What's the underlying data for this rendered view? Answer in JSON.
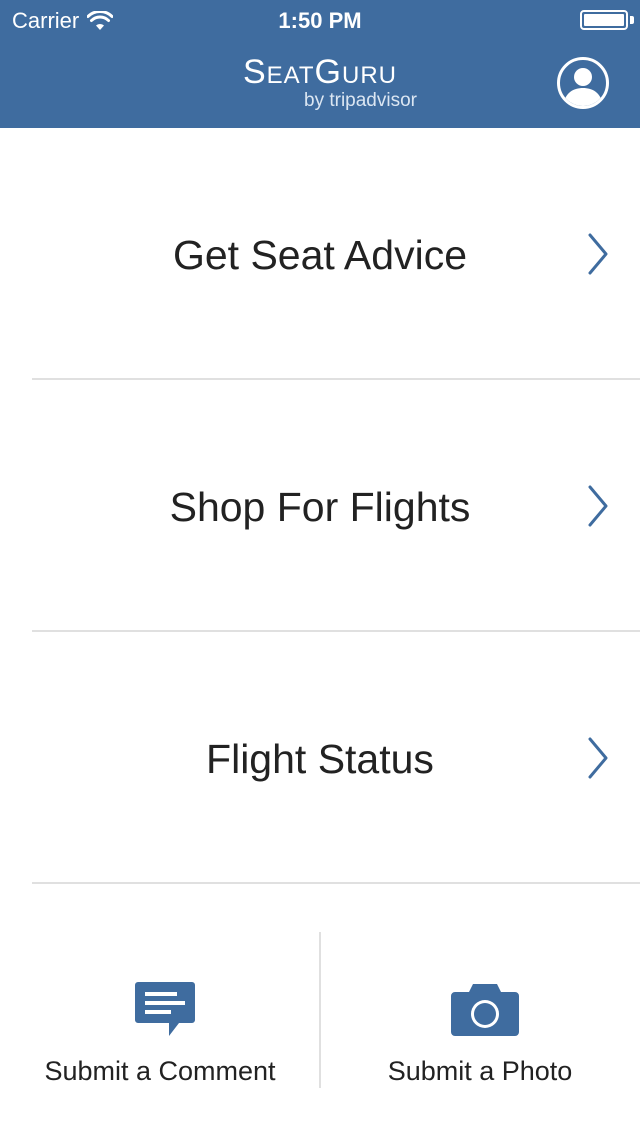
{
  "status_bar": {
    "carrier": "Carrier",
    "time": "1:50 PM"
  },
  "header": {
    "logo_main": "SeatGuru",
    "logo_sub": "by tripadvisor",
    "background_color": "#3f6c9f"
  },
  "menu": {
    "items": [
      {
        "label": "Get Seat Advice"
      },
      {
        "label": "Shop For Flights"
      },
      {
        "label": "Flight Status"
      }
    ],
    "chevron_color": "#3f6c9f"
  },
  "bottom_actions": {
    "comment_label": "Submit a Comment",
    "photo_label": "Submit a Photo",
    "icon_color": "#3f6c9f"
  },
  "icons": [
    "wifi-icon",
    "battery-icon",
    "profile-icon",
    "chevron-right-icon",
    "comment-icon",
    "camera-icon"
  ]
}
